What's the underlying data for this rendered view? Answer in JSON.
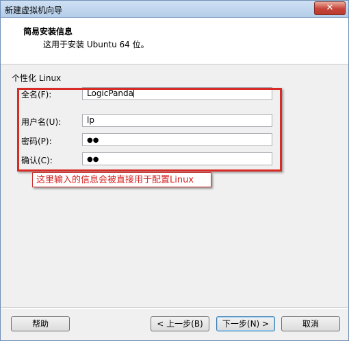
{
  "window": {
    "title": "新建虚拟机向导",
    "close_glyph": "✕"
  },
  "header": {
    "title": "简易安装信息",
    "subtitle": "这用于安装 Ubuntu 64 位。"
  },
  "form": {
    "group_label": "个性化 Linux",
    "full_name_label": "全名(F):",
    "full_name_value": "LogicPanda",
    "username_label": "用户名(U):",
    "username_value": "lp",
    "password_label": "密码(P):",
    "password_value": "●●",
    "confirm_label": "确认(C):",
    "confirm_value": "●●"
  },
  "annotation": {
    "text": "这里输入的信息会被直接用于配置Linux"
  },
  "buttons": {
    "help": "帮助",
    "back": "< 上一步(B)",
    "next": "下一步(N) >",
    "cancel": "取消"
  },
  "colors": {
    "annotation_red": "#d92b25",
    "title_bar": "#b4cde9"
  }
}
